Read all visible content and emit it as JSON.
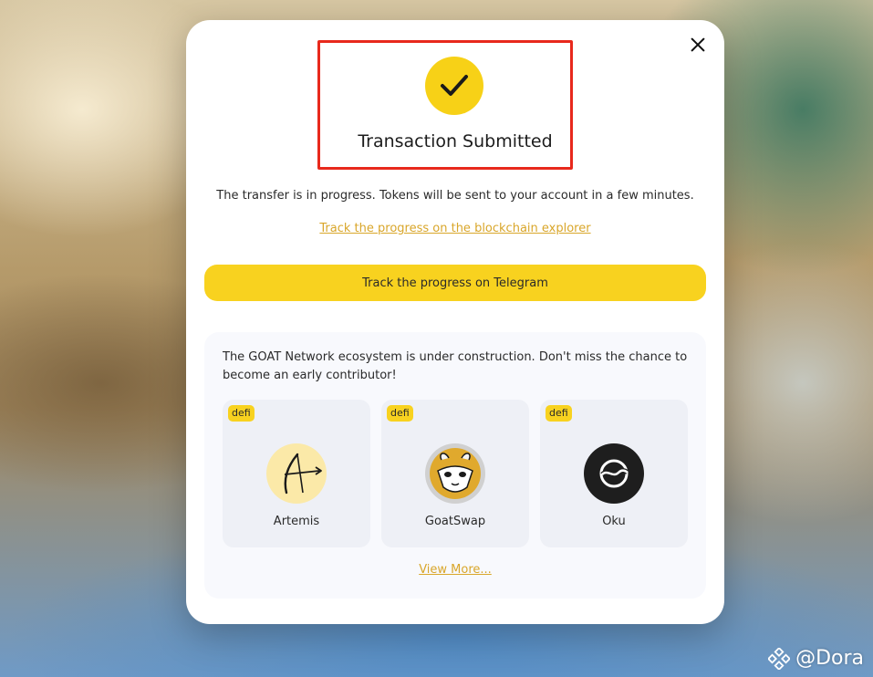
{
  "modal": {
    "title": "Transaction Submitted",
    "description": "The transfer is in progress. Tokens will be sent to your account in a few minutes.",
    "explorer_link": "Track the progress on the blockchain explorer",
    "telegram_button": "Track the progress on Telegram"
  },
  "ecosystem": {
    "text": "The GOAT Network ecosystem is under construction. Don't miss the chance to become an early contributor!",
    "projects": [
      {
        "tag": "defi",
        "name": "Artemis",
        "icon": "bow-arrow-icon"
      },
      {
        "tag": "defi",
        "name": "GoatSwap",
        "icon": "goat-icon"
      },
      {
        "tag": "defi",
        "name": "Oku",
        "icon": "oku-icon"
      }
    ],
    "view_more": "View More..."
  },
  "watermark": {
    "text": "@Dora",
    "icon": "binance-logo-icon"
  },
  "colors": {
    "accent": "#f8d21f",
    "link": "#d9a62a",
    "highlight_border": "#e8291c",
    "panel_bg": "#f8f9fd",
    "card_bg": "#eef0f6"
  }
}
